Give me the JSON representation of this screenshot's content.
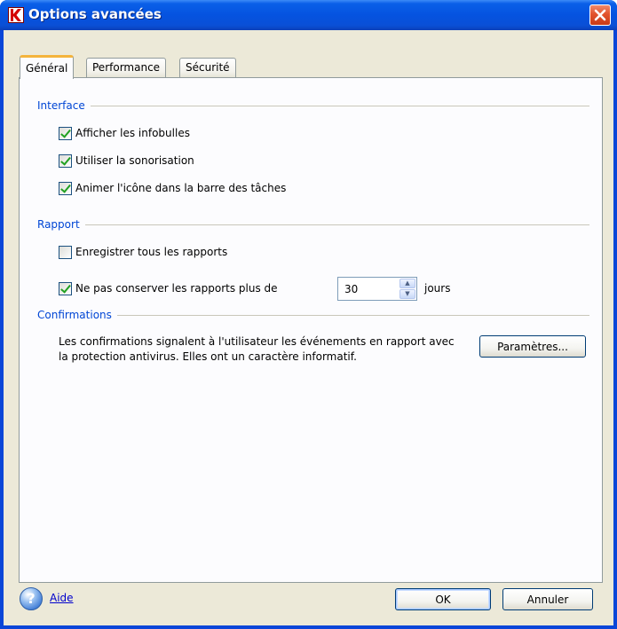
{
  "window": {
    "title": "Options avancées",
    "colors": {
      "titlebar": "#0553e0",
      "link": "#0046d5",
      "check": "#21a121"
    }
  },
  "tabs": [
    {
      "label": "Général",
      "active": true
    },
    {
      "label": "Performance",
      "active": false
    },
    {
      "label": "Sécurité",
      "active": false
    }
  ],
  "interface": {
    "header": "Interface",
    "options": [
      {
        "label": "Afficher les infobulles",
        "checked": true
      },
      {
        "label": "Utiliser la sonorisation",
        "checked": true
      },
      {
        "label": "Animer l'icône dans la barre des tâches",
        "checked": true
      }
    ]
  },
  "rapport": {
    "header": "Rapport",
    "save_all": {
      "label": "Enregistrer tous les rapports",
      "checked": false
    },
    "limit": {
      "label": "Ne pas conserver les rapports plus de",
      "checked": true,
      "value": "30",
      "unit": "jours"
    }
  },
  "confirmations": {
    "header": "Confirmations",
    "text": "Les confirmations signalent à l'utilisateur les événements en rapport avec la protection antivirus. Elles ont un caractère informatif.",
    "params_label": "Paramètres..."
  },
  "footer": {
    "help_label": "Aide",
    "ok_label": "OK",
    "cancel_label": "Annuler"
  }
}
